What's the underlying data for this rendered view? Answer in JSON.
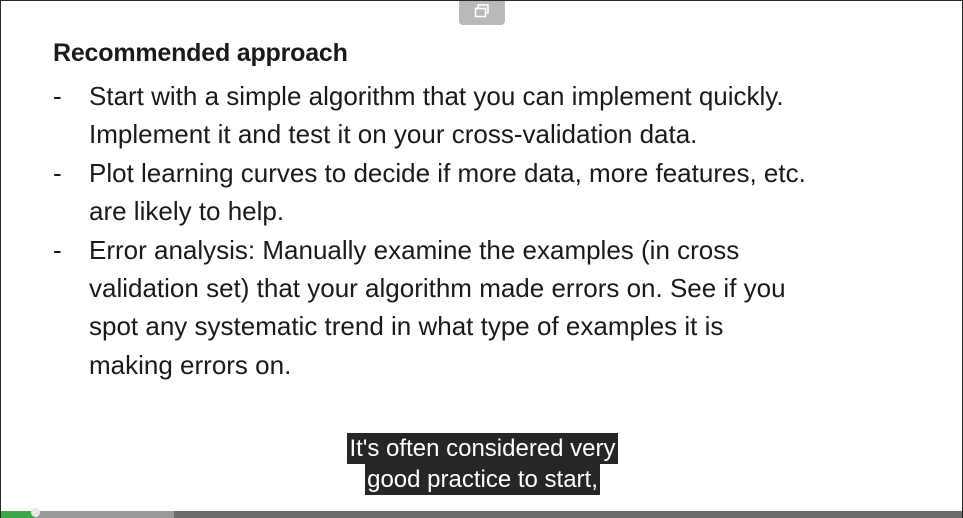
{
  "slide": {
    "title": "Recommended approach",
    "bullets": [
      {
        "marker": "-",
        "text": "Start with a simple algorithm that you can implement quickly.\nImplement it and test it on your cross-validation data."
      },
      {
        "marker": "-",
        "text": "Plot learning curves to decide if more data, more features, etc.\nare likely to help."
      },
      {
        "marker": "-",
        "text": "Error analysis:  Manually examine the examples (in cross\nvalidation set) that your algorithm made errors on. See if you\nspot any systematic trend in what type of examples it is\nmaking errors on."
      }
    ]
  },
  "captions": {
    "line1": "It's often considered very",
    "line2": "good practice to start,"
  },
  "player": {
    "popout_icon": "popout-icon",
    "progress_played": 0.035,
    "progress_buffered": 0.18
  }
}
